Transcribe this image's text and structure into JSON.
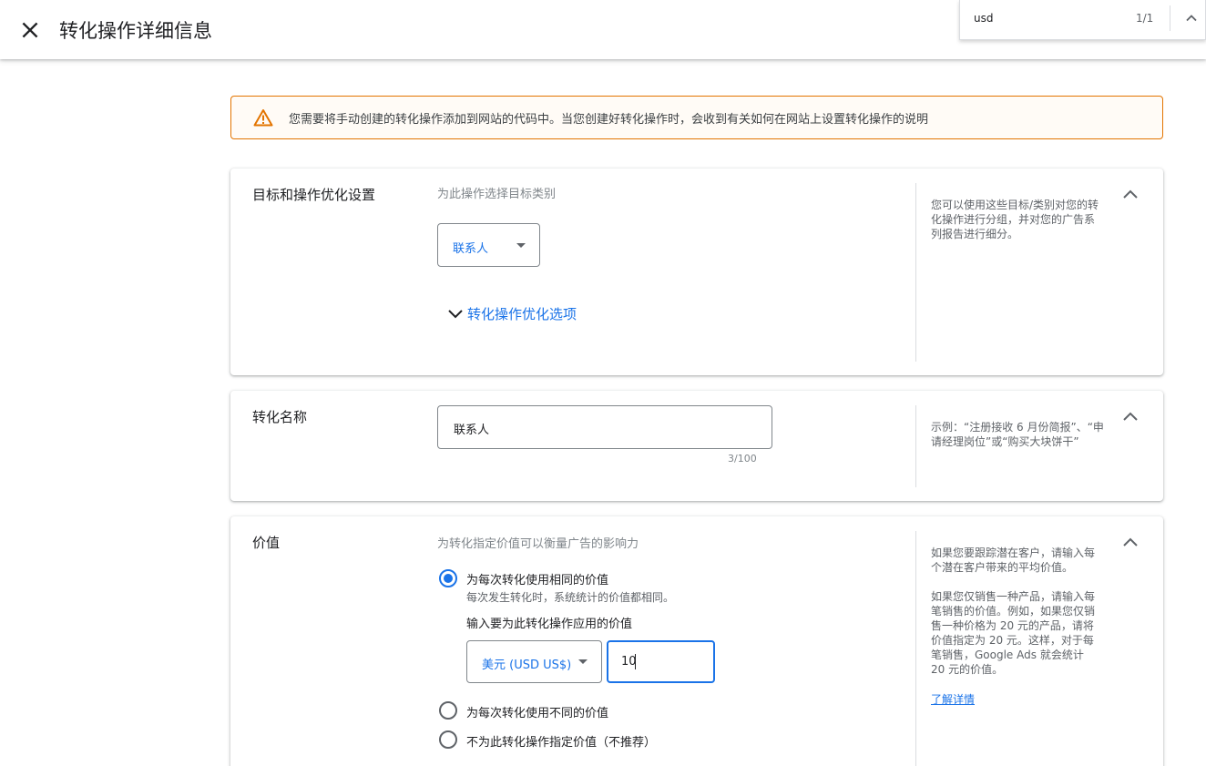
{
  "header": {
    "title": "转化操作详细信息"
  },
  "find_bar": {
    "query": "usd",
    "count": "1/1"
  },
  "warning": {
    "text": "您需要将手动创建的转化操作添加到网站的代码中。当您创建好转化操作时，会收到有关如何在网站上设置转化操作的说明"
  },
  "goal_section": {
    "title": "目标和操作优化设置",
    "category_label": "为此操作选择目标类别",
    "category_value": "联系人",
    "expander_label": "转化操作优化选项",
    "hint": "您可以使用这些目标/类别对您的转化操作进行分组，并对您的广告系列报告进行细分。"
  },
  "name_section": {
    "title": "转化名称",
    "input_value": "联系人",
    "char_count": "3/100",
    "hint": "示例：“注册接收 6 月份简报”、“申请经理岗位”或“购买大块饼干”"
  },
  "value_section": {
    "title": "价值",
    "subtitle": "为转化指定价值可以衡量广告的影响力",
    "options": [
      {
        "label": "为每次转化使用相同的价值",
        "description": "每次发生转化时，系统统计的价值都相同。",
        "checked": true
      },
      {
        "label": "为每次转化使用不同的价值",
        "checked": false
      },
      {
        "label": "不为此转化操作指定价值（不推荐）",
        "checked": false
      }
    ],
    "input_prompt": "输入要为此转化操作应用的价值",
    "currency": "美元 (USD US$)",
    "amount": "10",
    "hint_1": "如果您要跟踪潜在客户，请输入每个潜在客户带来的平均价值。",
    "hint_2": "如果您仅销售一种产品，请输入每笔销售的价值。例如，如果您仅销售一种价格为 20 元的产品，请将价值指定为 20 元。这样，对于每笔销售，Google Ads 就会统计 20 元的价值。",
    "learn_more": "了解详情"
  },
  "colors": {
    "accent": "#1a73e8",
    "warning": "#e37400"
  },
  "icons": [
    "close-icon",
    "chevron-up-icon",
    "warning-icon",
    "chevron-down-icon",
    "dropdown-caret-icon"
  ]
}
